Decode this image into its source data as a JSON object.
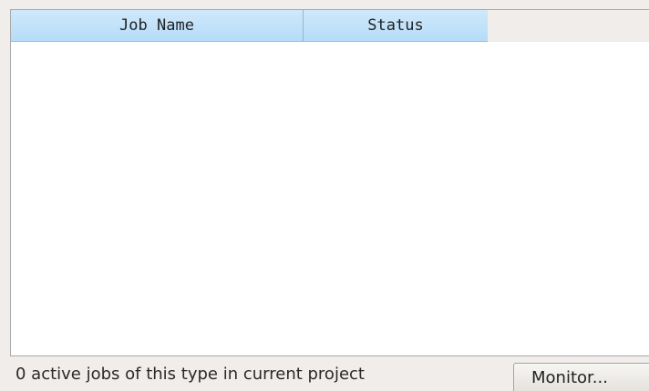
{
  "table": {
    "columns": [
      "Job Name",
      "Status"
    ],
    "rows": []
  },
  "footer": {
    "status_text": "0 active jobs of this type in current project",
    "monitor_label": "Monitor..."
  }
}
